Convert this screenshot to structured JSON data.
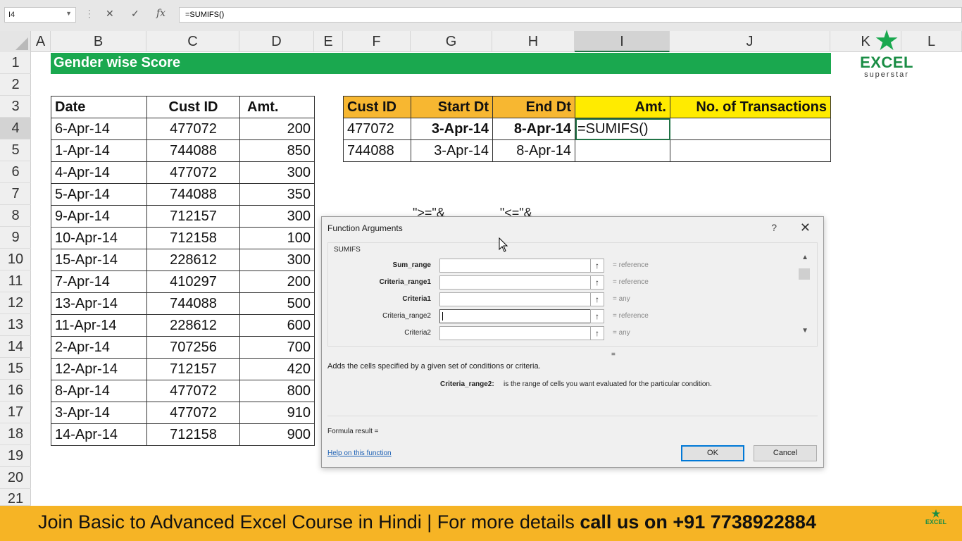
{
  "formula_bar": {
    "name_box": "I4",
    "formula": "=SUMIFS()",
    "cancel_icon": "✕",
    "enter_icon": "✓",
    "fx_icon": "fx"
  },
  "columns": [
    "A",
    "B",
    "C",
    "D",
    "E",
    "F",
    "G",
    "H",
    "I",
    "J",
    "K",
    "L"
  ],
  "rows": [
    "1",
    "2",
    "3",
    "4",
    "5",
    "6",
    "7",
    "8",
    "9",
    "10",
    "11",
    "12",
    "13",
    "14",
    "15",
    "16",
    "17",
    "18",
    "19",
    "20",
    "21"
  ],
  "title": "Gender wise Score",
  "logo": {
    "line1": "EXCEL",
    "line2": "superstar"
  },
  "data_table": {
    "headers": [
      "Date",
      "Cust ID",
      "Amt."
    ],
    "rows": [
      [
        "6-Apr-14",
        "477072",
        "200"
      ],
      [
        "1-Apr-14",
        "744088",
        "850"
      ],
      [
        "4-Apr-14",
        "477072",
        "300"
      ],
      [
        "5-Apr-14",
        "744088",
        "350"
      ],
      [
        "9-Apr-14",
        "712157",
        "300"
      ],
      [
        "10-Apr-14",
        "712158",
        "100"
      ],
      [
        "15-Apr-14",
        "228612",
        "300"
      ],
      [
        "7-Apr-14",
        "410297",
        "200"
      ],
      [
        "13-Apr-14",
        "744088",
        "500"
      ],
      [
        "11-Apr-14",
        "228612",
        "600"
      ],
      [
        "2-Apr-14",
        "707256",
        "700"
      ],
      [
        "12-Apr-14",
        "712157",
        "420"
      ],
      [
        "8-Apr-14",
        "477072",
        "800"
      ],
      [
        "3-Apr-14",
        "477072",
        "910"
      ],
      [
        "14-Apr-14",
        "712158",
        "900"
      ]
    ]
  },
  "criteria_table": {
    "headers": [
      "Cust ID",
      "Start Dt",
      "End Dt",
      "Amt.",
      "No. of Transactions"
    ],
    "rows": [
      [
        "477072",
        "3-Apr-14",
        "8-Apr-14",
        "=SUMIFS()",
        ""
      ],
      [
        "744088",
        "3-Apr-14",
        "8-Apr-14",
        "",
        ""
      ]
    ]
  },
  "partial_text": [
    "\">=\"&",
    "\"<=\"&"
  ],
  "dialog": {
    "title": "Function Arguments",
    "help": "?",
    "close": "✕",
    "function_name": "SUMIFS",
    "args": [
      {
        "label": "Sum_range",
        "hint": "=  reference"
      },
      {
        "label": "Criteria_range1",
        "hint": "=  reference"
      },
      {
        "label": "Criteria1",
        "hint": "=  any"
      },
      {
        "label": "Criteria_range2",
        "hint": "=  reference"
      },
      {
        "label": "Criteria2",
        "hint": "=  any"
      }
    ],
    "arrow_icon": "🠕",
    "equals": "=",
    "description": "Adds the cells specified by a given set of conditions or criteria.",
    "arg_desc_name": "Criteria_range2:",
    "arg_desc_text": "is the range of cells you want evaluated for the particular condition.",
    "formula_result": "Formula result =",
    "help_link": "Help on this function",
    "ok": "OK",
    "cancel": "Cancel"
  },
  "banner": {
    "text": "Join Basic to Advanced Excel Course in Hindi | For more details ",
    "bold": "call us on +91 7738922884",
    "logo": "EXCEL"
  }
}
